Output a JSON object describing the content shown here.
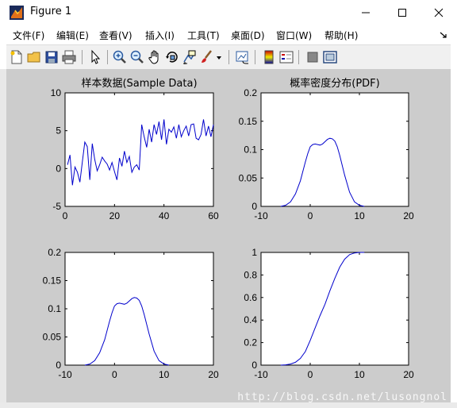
{
  "window": {
    "title": "Figure 1",
    "controls": [
      "minimize",
      "maximize",
      "close"
    ]
  },
  "menu": [
    {
      "label": "文件(F)"
    },
    {
      "label": "编辑(E)"
    },
    {
      "label": "查看(V)"
    },
    {
      "label": "插入(I)"
    },
    {
      "label": "工具(T)"
    },
    {
      "label": "桌面(D)"
    },
    {
      "label": "窗口(W)"
    },
    {
      "label": "帮助(H)"
    }
  ],
  "toolbar": {
    "icons": [
      "new-figure-icon",
      "open-file-icon",
      "save-icon",
      "print-icon",
      "pointer-icon",
      "zoom-in-icon",
      "zoom-out-icon",
      "pan-icon",
      "rotate-3d-icon",
      "data-cursor-icon",
      "brush-icon",
      "link-plot-icon",
      "colorbar-icon",
      "legend-icon",
      "hide-plot-tools-icon",
      "show-plot-tools-icon"
    ]
  },
  "watermark": "http://blog.csdn.net/lusongnol",
  "colors": {
    "line": "#0000cc",
    "figure_bg": "#cccccc",
    "axes_bg": "#ffffff"
  },
  "chart_data": [
    {
      "type": "line",
      "title": "样本数据(Sample Data)",
      "xlim": [
        0,
        60
      ],
      "ylim": [
        -5,
        10
      ],
      "xticks": [
        0,
        20,
        40,
        60
      ],
      "yticks": [
        -5,
        0,
        5,
        10
      ],
      "x": [
        1,
        2,
        3,
        4,
        5,
        6,
        7,
        8,
        9,
        10,
        11,
        12,
        13,
        14,
        15,
        16,
        17,
        18,
        19,
        20,
        21,
        22,
        23,
        24,
        25,
        26,
        27,
        28,
        29,
        30,
        31,
        32,
        33,
        34,
        35,
        36,
        37,
        38,
        39,
        40,
        41,
        42,
        43,
        44,
        45,
        46,
        47,
        48,
        49,
        50,
        51,
        52,
        53,
        54,
        55,
        56,
        57,
        58,
        59,
        60
      ],
      "y": [
        0.5,
        1.8,
        -2.2,
        0.2,
        -0.5,
        -1.8,
        0.9,
        3.5,
        2.9,
        -1.5,
        3.3,
        1.2,
        -0.3,
        0.5,
        1.5,
        1.0,
        0.6,
        -0.2,
        0.8,
        -0.4,
        -1.5,
        1.4,
        0.3,
        2.3,
        0.8,
        1.6,
        -0.5,
        0.2,
        0.5,
        -0.2,
        5.8,
        4.2,
        2.8,
        5.2,
        3.5,
        5.8,
        4.5,
        6.2,
        3.8,
        6.5,
        3.2,
        5.2,
        4.8,
        5.5,
        4.0,
        5.8,
        4.2,
        5.0,
        5.6,
        4.3,
        5.8,
        5.9,
        4.0,
        3.8,
        4.5,
        6.5,
        4.3,
        5.6,
        4.2,
        5.8
      ]
    },
    {
      "type": "line",
      "title": "概率密度分布(PDF)",
      "xlim": [
        -10,
        20
      ],
      "ylim": [
        0,
        0.2
      ],
      "xticks": [
        -10,
        0,
        10,
        20
      ],
      "yticks": [
        0,
        0.05,
        0.1,
        0.15,
        0.2
      ],
      "x": [
        -6,
        -5,
        -4,
        -3,
        -2,
        -1,
        -0.5,
        0,
        0.5,
        1,
        1.5,
        2,
        2.5,
        3,
        3.5,
        4,
        4.5,
        5,
        5.5,
        6,
        7,
        8,
        9,
        10,
        11
      ],
      "y": [
        0.0,
        0.002,
        0.008,
        0.022,
        0.045,
        0.078,
        0.093,
        0.105,
        0.109,
        0.11,
        0.109,
        0.108,
        0.11,
        0.114,
        0.118,
        0.12,
        0.119,
        0.115,
        0.105,
        0.09,
        0.055,
        0.025,
        0.008,
        0.002,
        0.0
      ]
    },
    {
      "type": "line",
      "xlim": [
        -10,
        20
      ],
      "ylim": [
        0,
        0.2
      ],
      "xticks": [
        -10,
        0,
        10,
        20
      ],
      "yticks": [
        0,
        0.05,
        0.1,
        0.15,
        0.2
      ],
      "x": [
        -6,
        -5,
        -4,
        -3,
        -2,
        -1,
        -0.5,
        0,
        0.5,
        1,
        1.5,
        2,
        2.5,
        3,
        3.5,
        4,
        4.5,
        5,
        5.5,
        6,
        7,
        8,
        9,
        10,
        11
      ],
      "y": [
        0.0,
        0.002,
        0.008,
        0.022,
        0.045,
        0.078,
        0.093,
        0.105,
        0.109,
        0.11,
        0.109,
        0.108,
        0.11,
        0.114,
        0.118,
        0.12,
        0.119,
        0.115,
        0.105,
        0.09,
        0.055,
        0.025,
        0.008,
        0.002,
        0.0
      ]
    },
    {
      "type": "line",
      "xlim": [
        -10,
        20
      ],
      "ylim": [
        0,
        1
      ],
      "xticks": [
        -10,
        0,
        10,
        20
      ],
      "yticks": [
        0,
        0.2,
        0.4,
        0.6,
        0.8,
        1
      ],
      "x": [
        -6,
        -5,
        -4,
        -3,
        -2,
        -1,
        0,
        1,
        2,
        3,
        4,
        5,
        6,
        7,
        8,
        9,
        10,
        11
      ],
      "y": [
        0.0,
        0.003,
        0.01,
        0.025,
        0.06,
        0.12,
        0.22,
        0.33,
        0.44,
        0.54,
        0.66,
        0.77,
        0.87,
        0.94,
        0.98,
        0.995,
        1.0,
        1.0
      ]
    }
  ]
}
